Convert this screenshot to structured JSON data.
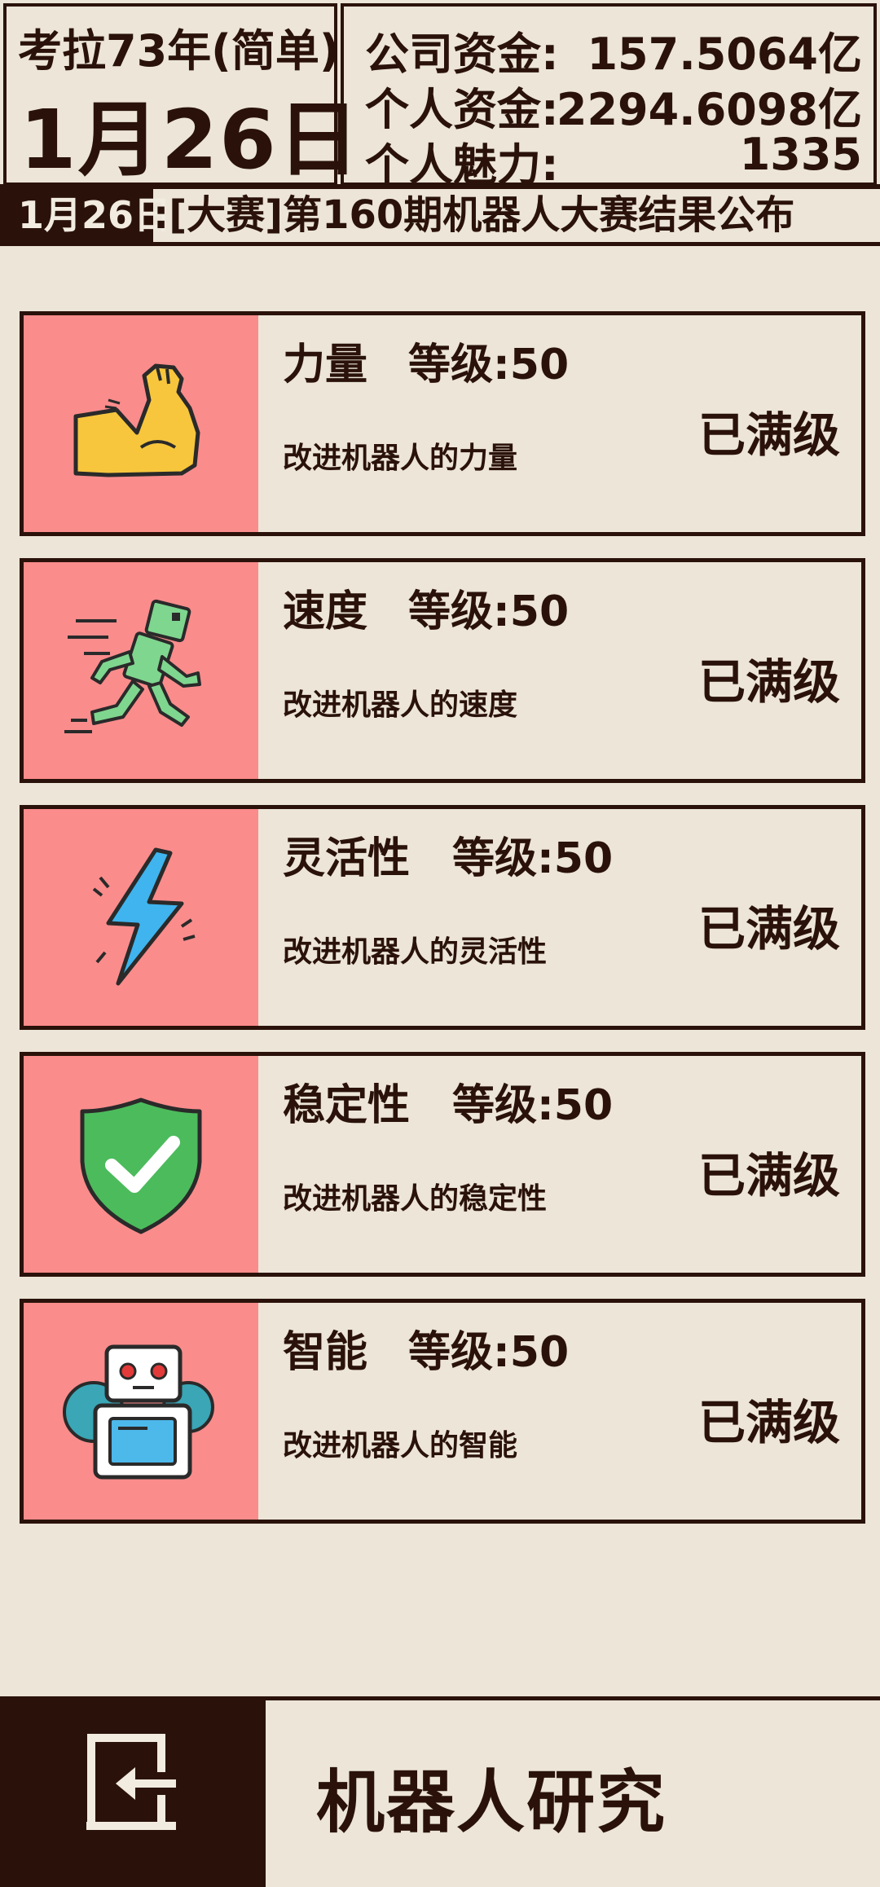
{
  "header": {
    "year": "考拉73年(简单)",
    "day": "1月26日",
    "funds": [
      {
        "label": "公司资金:",
        "value": "157.5064亿"
      },
      {
        "label": "个人资金:",
        "value": "2294.6098亿"
      },
      {
        "label": "个人魅力:",
        "value": "1335"
      }
    ]
  },
  "ticker": {
    "date": "1月26日",
    "text": ":[大赛]第160期机器人大赛结果公布"
  },
  "cards": [
    {
      "title": "力量",
      "level": "等级:50",
      "desc": "改进机器人的力量",
      "status": "已满级",
      "icon": "flexed-arm-icon"
    },
    {
      "title": "速度",
      "level": "等级:50",
      "desc": "改进机器人的速度",
      "status": "已满级",
      "icon": "running-robot-icon"
    },
    {
      "title": "灵活性",
      "level": "等级:50",
      "desc": "改进机器人的灵活性",
      "status": "已满级",
      "icon": "lightning-icon"
    },
    {
      "title": "稳定性",
      "level": "等级:50",
      "desc": "改进机器人的稳定性",
      "status": "已满级",
      "icon": "shield-check-icon"
    },
    {
      "title": "智能",
      "level": "等级:50",
      "desc": "改进机器人的智能",
      "status": "已满级",
      "icon": "robot-gear-icon"
    }
  ],
  "bottom": {
    "title": "机器人研究",
    "back_icon": "exit-door-icon"
  },
  "colors": {
    "background": "#ece5d8",
    "dark": "#2a120a",
    "icon_panel": "#fb8c8c"
  }
}
